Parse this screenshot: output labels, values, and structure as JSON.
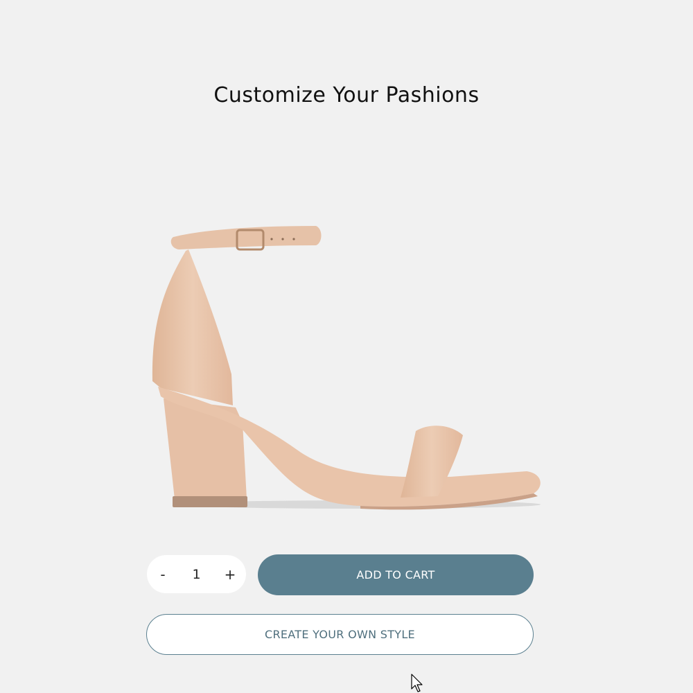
{
  "page": {
    "title": "Customize Your Pashions"
  },
  "product": {
    "image": "nude-block-heel-ankle-strap-sandal",
    "color": "#e9c4aa"
  },
  "cart": {
    "decrement_label": "-",
    "quantity": "1",
    "increment_label": "+",
    "add_to_cart_label": "ADD TO CART",
    "create_style_label": "CREATE YOUR OWN STYLE"
  },
  "colors": {
    "accent": "#5a7f8f",
    "background": "#f1f1f1"
  },
  "cursor": {
    "icon": "mouse-pointer-icon"
  }
}
